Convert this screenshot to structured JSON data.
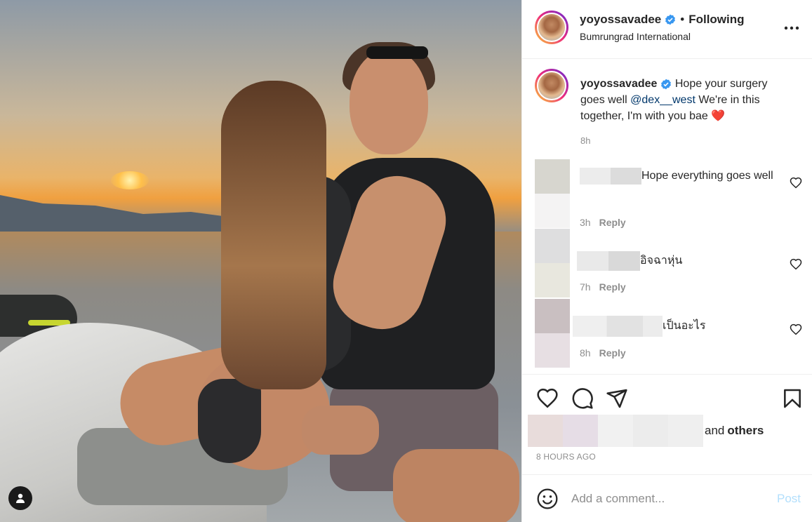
{
  "header": {
    "username": "yoyossavadee",
    "separator": "•",
    "follow_status": "Following",
    "location": "Bumrungrad International"
  },
  "caption": {
    "username": "yoyossavadee",
    "text_before": "Hope your surgery goes well ",
    "mention": "@dex__west",
    "text_after": " We're in this together, I'm with you bae",
    "emoji": "❤️",
    "time": "8h"
  },
  "comments": [
    {
      "text": "Hope everything goes well",
      "time": "3h",
      "reply": "Reply"
    },
    {
      "text": "อิจฉาหุ่น",
      "time": "7h",
      "reply": "Reply"
    },
    {
      "text": "เป็นอะไร",
      "time": "8h",
      "reply": "Reply"
    }
  ],
  "likes": {
    "and": "and",
    "others": "others"
  },
  "timestamp": "8 HOURS AGO",
  "add_comment": {
    "placeholder": "Add a comment...",
    "post_label": "Post"
  },
  "icons": [
    "tag-user-icon",
    "verified-icon",
    "more-options-icon",
    "heart-icon",
    "comment-icon",
    "share-icon",
    "save-icon",
    "emoji-icon"
  ],
  "colors": {
    "verified": "#3897f0",
    "mention": "#00376b",
    "post_disabled": "#b2dffc",
    "muted": "#8e8e8e",
    "heart": "#ed4956"
  }
}
